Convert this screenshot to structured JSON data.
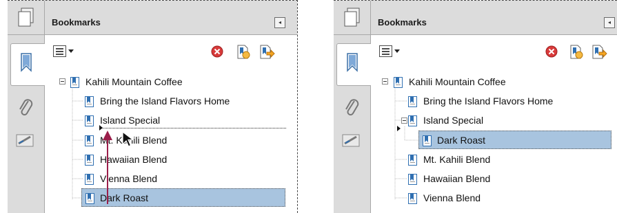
{
  "colors": {
    "panel_bg": "#dcdcdc",
    "selection": "#a8c4df",
    "drag_arrow": "#9b1e4a",
    "delete_red": "#d83a3a",
    "bookmark_blue": "#2f6fb1"
  },
  "left_panel": {
    "title": "Bookmarks",
    "collapse_glyph": "◂",
    "icons": [
      "pages-icon",
      "bookmarks-icon",
      "attachment-icon",
      "signature-icon",
      "options-menu-icon",
      "delete-bookmark-icon",
      "new-bookmark-icon",
      "expand-bookmark-icon"
    ],
    "bookmarks": [
      {
        "label": "Kahili Mountain Coffee"
      },
      {
        "label": "Bring the Island Flavors Home"
      },
      {
        "label": "Island Special"
      },
      {
        "label": "Mt. Kahili Blend"
      },
      {
        "label": "Hawaiian Blend"
      },
      {
        "label": "Vienna Blend"
      },
      {
        "label": "Dark Roast",
        "selected": true
      }
    ]
  },
  "right_panel": {
    "title": "Bookmarks",
    "collapse_glyph": "◂",
    "bookmarks": [
      {
        "label": "Kahili Mountain Coffee"
      },
      {
        "label": "Bring the Island Flavors Home"
      },
      {
        "label": "Island Special"
      },
      {
        "label": "Dark Roast",
        "selected": true
      },
      {
        "label": "Mt. Kahili Blend"
      },
      {
        "label": "Hawaiian Blend"
      },
      {
        "label": "Vienna Blend"
      }
    ]
  }
}
